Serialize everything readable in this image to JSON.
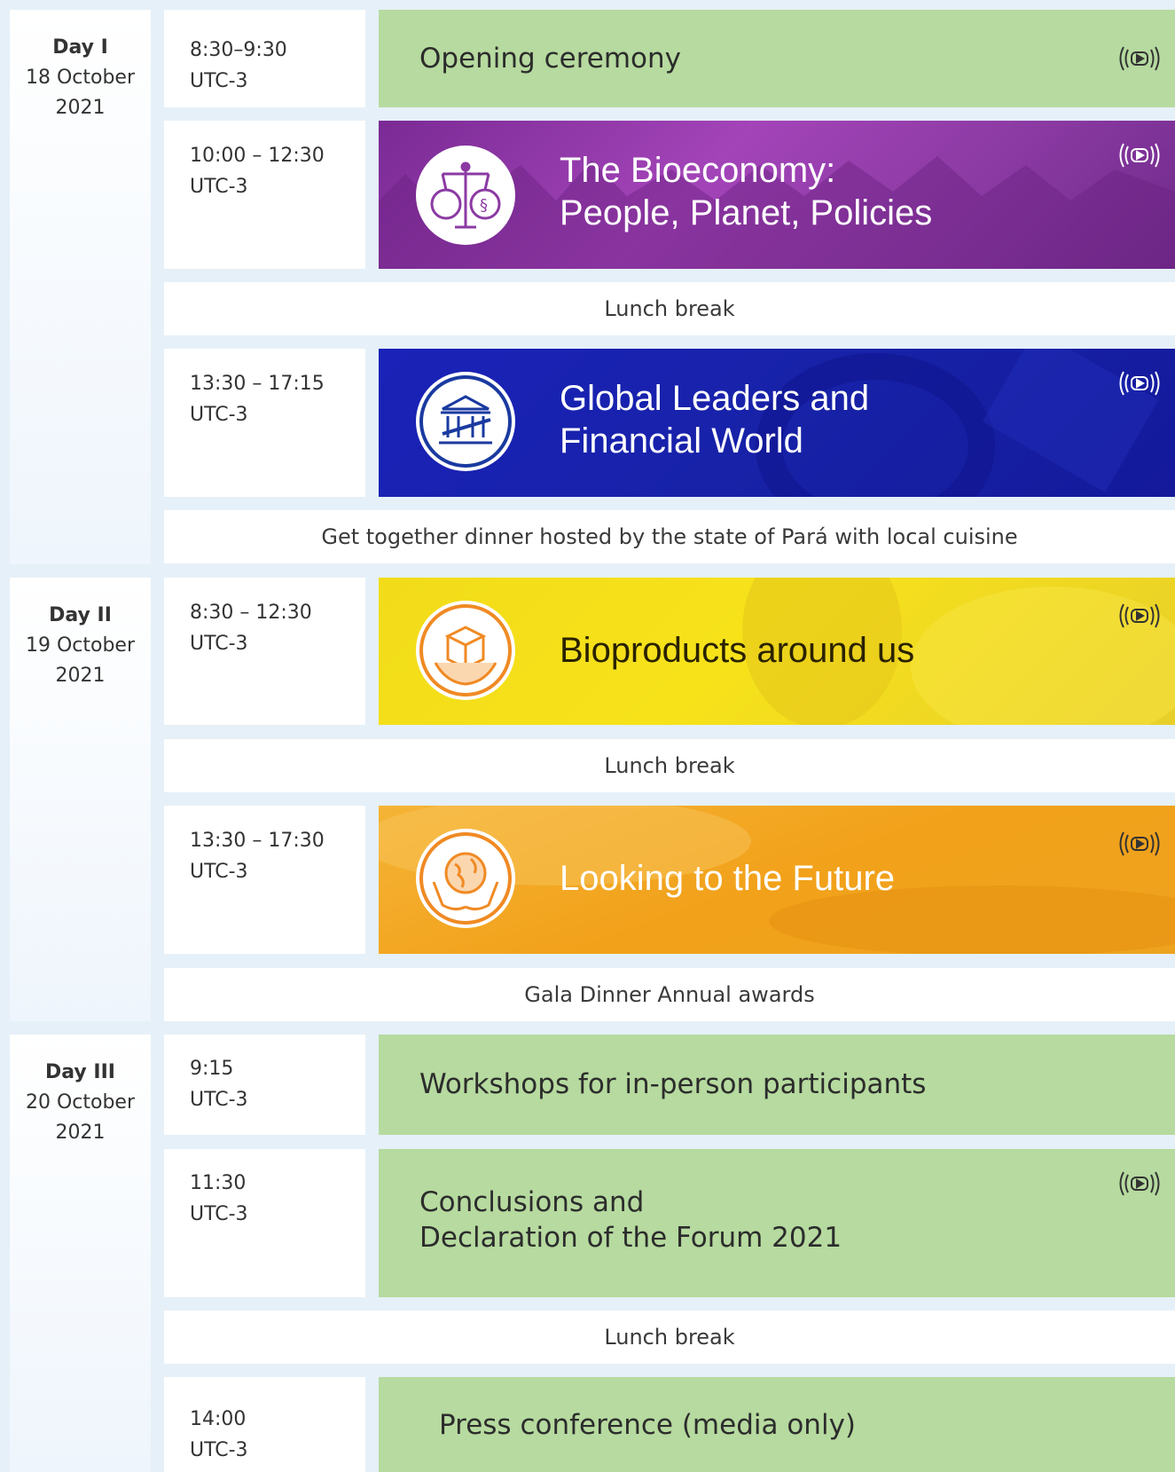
{
  "days": [
    {
      "name": "Day I",
      "date_line1": "18 October",
      "date_line2": "2021"
    },
    {
      "name": "Day II",
      "date_line1": "19 October",
      "date_line2": "2021"
    },
    {
      "name": "Day III",
      "date_line1": "20 October",
      "date_line2": "2021"
    }
  ],
  "times": [
    {
      "time": "8:30–9:30",
      "zone": "UTC-3"
    },
    {
      "time": "10:00 – 12:30",
      "zone": "UTC-3"
    },
    {
      "time": "13:30 – 17:15",
      "zone": "UTC-3"
    },
    {
      "time": "8:30 – 12:30",
      "zone": "UTC-3"
    },
    {
      "time": "13:30 – 17:30",
      "zone": "UTC-3"
    },
    {
      "time": "9:15",
      "zone": "UTC-3"
    },
    {
      "time": "11:30",
      "zone": "UTC-3"
    },
    {
      "time": "14:00",
      "zone": "UTC-3"
    }
  ],
  "sessions": [
    {
      "line1": "Opening ceremony",
      "line2": ""
    },
    {
      "line1": "The Bioeconomy:",
      "line2": "People, Planet, Policies"
    },
    {
      "line1": "Global Leaders and",
      "line2": "Financial World"
    },
    {
      "line1": "Bioproducts around us",
      "line2": ""
    },
    {
      "line1": "Looking to the Future",
      "line2": ""
    },
    {
      "line1": "Workshops for in-person participants",
      "line2": ""
    },
    {
      "line1": "Conclusions and",
      "line2": "Declaration of the Forum 2021"
    },
    {
      "line1": "Press conference (media only)",
      "line2": ""
    }
  ],
  "breaks": [
    "Lunch break",
    "Get together dinner hosted by the state of Pará with local cuisine",
    "Lunch break",
    "Gala Dinner Annual awards",
    "Lunch break"
  ],
  "icons": {
    "stream": "live-stream-icon",
    "emblem_bioeconomy": "scales-globe-icon",
    "emblem_finance": "bank-building-icon",
    "emblem_bioproducts": "box-hands-icon",
    "emblem_future": "globe-hands-icon"
  },
  "colors": {
    "green_session": "#b6da9f",
    "purple_session": "#8b3aa3",
    "blue_session": "#1722a8",
    "yellow_session": "#f3de1c",
    "orange_session": "#f2a11a",
    "background": "#e6f0f8"
  }
}
